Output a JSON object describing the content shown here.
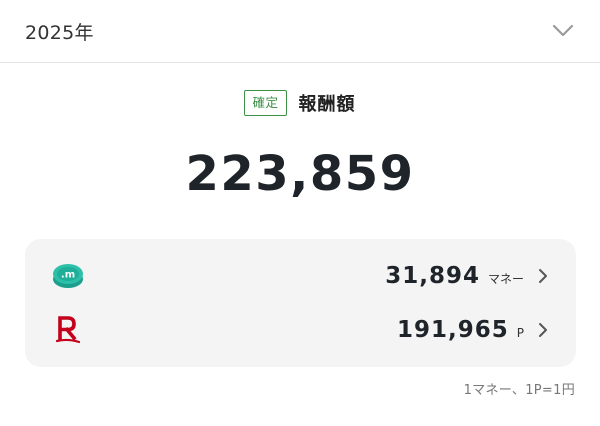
{
  "year_selector": {
    "label": "2025年",
    "icon": "chevron-down-icon"
  },
  "summary": {
    "badge": "確定",
    "title": "報酬額",
    "total": "223,859",
    "accent_color": "#3d8f46"
  },
  "breakdown": [
    {
      "icon": "rakuten-money-icon",
      "amount": "31,894",
      "unit": "マネー"
    },
    {
      "icon": "rakuten-r-icon",
      "amount": "191,965",
      "unit": "P"
    }
  ],
  "footnote": "1マネー、1P=1円"
}
